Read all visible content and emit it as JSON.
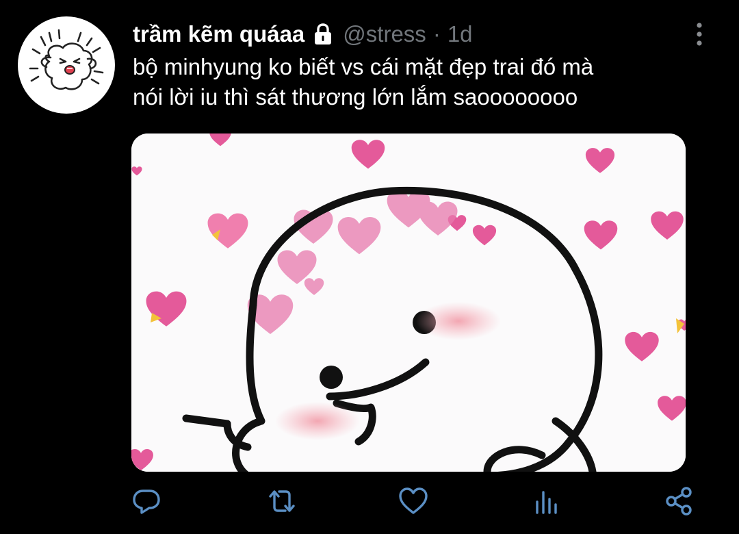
{
  "tweet": {
    "display_name": "trầm kẽm quáaa",
    "handle": "@stress",
    "separator": "·",
    "time": "1d",
    "text_lines": [
      "bộ minhyung ko biết vs cái mặt đẹp trai đó mà",
      "nói lời iu thì sát thương lớn lắm saoooooooo"
    ],
    "protected": true
  },
  "icons": {
    "avatar": "cartoon-bunny-avatar",
    "lock": "lock-icon",
    "more": "more-vertical-icon",
    "reply": "reply-icon",
    "retweet": "retweet-icon",
    "like": "heart-icon",
    "analytics": "analytics-icon",
    "share": "share-icon"
  },
  "colors": {
    "background": "#000000",
    "text_primary": "#ffffff",
    "text_secondary": "#71767b",
    "action_icon": "#5b8fc4",
    "heart_pink": "#e8609b"
  }
}
